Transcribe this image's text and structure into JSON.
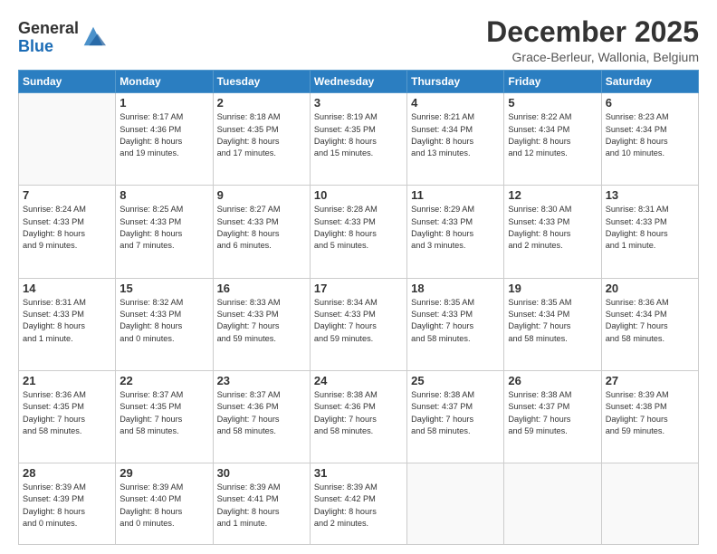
{
  "logo": {
    "general": "General",
    "blue": "Blue"
  },
  "header": {
    "month": "December 2025",
    "location": "Grace-Berleur, Wallonia, Belgium"
  },
  "days_header": [
    "Sunday",
    "Monday",
    "Tuesday",
    "Wednesday",
    "Thursday",
    "Friday",
    "Saturday"
  ],
  "weeks": [
    [
      {
        "day": "",
        "info": ""
      },
      {
        "day": "1",
        "info": "Sunrise: 8:17 AM\nSunset: 4:36 PM\nDaylight: 8 hours\nand 19 minutes."
      },
      {
        "day": "2",
        "info": "Sunrise: 8:18 AM\nSunset: 4:35 PM\nDaylight: 8 hours\nand 17 minutes."
      },
      {
        "day": "3",
        "info": "Sunrise: 8:19 AM\nSunset: 4:35 PM\nDaylight: 8 hours\nand 15 minutes."
      },
      {
        "day": "4",
        "info": "Sunrise: 8:21 AM\nSunset: 4:34 PM\nDaylight: 8 hours\nand 13 minutes."
      },
      {
        "day": "5",
        "info": "Sunrise: 8:22 AM\nSunset: 4:34 PM\nDaylight: 8 hours\nand 12 minutes."
      },
      {
        "day": "6",
        "info": "Sunrise: 8:23 AM\nSunset: 4:34 PM\nDaylight: 8 hours\nand 10 minutes."
      }
    ],
    [
      {
        "day": "7",
        "info": "Sunrise: 8:24 AM\nSunset: 4:33 PM\nDaylight: 8 hours\nand 9 minutes."
      },
      {
        "day": "8",
        "info": "Sunrise: 8:25 AM\nSunset: 4:33 PM\nDaylight: 8 hours\nand 7 minutes."
      },
      {
        "day": "9",
        "info": "Sunrise: 8:27 AM\nSunset: 4:33 PM\nDaylight: 8 hours\nand 6 minutes."
      },
      {
        "day": "10",
        "info": "Sunrise: 8:28 AM\nSunset: 4:33 PM\nDaylight: 8 hours\nand 5 minutes."
      },
      {
        "day": "11",
        "info": "Sunrise: 8:29 AM\nSunset: 4:33 PM\nDaylight: 8 hours\nand 3 minutes."
      },
      {
        "day": "12",
        "info": "Sunrise: 8:30 AM\nSunset: 4:33 PM\nDaylight: 8 hours\nand 2 minutes."
      },
      {
        "day": "13",
        "info": "Sunrise: 8:31 AM\nSunset: 4:33 PM\nDaylight: 8 hours\nand 1 minute."
      }
    ],
    [
      {
        "day": "14",
        "info": "Sunrise: 8:31 AM\nSunset: 4:33 PM\nDaylight: 8 hours\nand 1 minute."
      },
      {
        "day": "15",
        "info": "Sunrise: 8:32 AM\nSunset: 4:33 PM\nDaylight: 8 hours\nand 0 minutes."
      },
      {
        "day": "16",
        "info": "Sunrise: 8:33 AM\nSunset: 4:33 PM\nDaylight: 7 hours\nand 59 minutes."
      },
      {
        "day": "17",
        "info": "Sunrise: 8:34 AM\nSunset: 4:33 PM\nDaylight: 7 hours\nand 59 minutes."
      },
      {
        "day": "18",
        "info": "Sunrise: 8:35 AM\nSunset: 4:33 PM\nDaylight: 7 hours\nand 58 minutes."
      },
      {
        "day": "19",
        "info": "Sunrise: 8:35 AM\nSunset: 4:34 PM\nDaylight: 7 hours\nand 58 minutes."
      },
      {
        "day": "20",
        "info": "Sunrise: 8:36 AM\nSunset: 4:34 PM\nDaylight: 7 hours\nand 58 minutes."
      }
    ],
    [
      {
        "day": "21",
        "info": "Sunrise: 8:36 AM\nSunset: 4:35 PM\nDaylight: 7 hours\nand 58 minutes."
      },
      {
        "day": "22",
        "info": "Sunrise: 8:37 AM\nSunset: 4:35 PM\nDaylight: 7 hours\nand 58 minutes."
      },
      {
        "day": "23",
        "info": "Sunrise: 8:37 AM\nSunset: 4:36 PM\nDaylight: 7 hours\nand 58 minutes."
      },
      {
        "day": "24",
        "info": "Sunrise: 8:38 AM\nSunset: 4:36 PM\nDaylight: 7 hours\nand 58 minutes."
      },
      {
        "day": "25",
        "info": "Sunrise: 8:38 AM\nSunset: 4:37 PM\nDaylight: 7 hours\nand 58 minutes."
      },
      {
        "day": "26",
        "info": "Sunrise: 8:38 AM\nSunset: 4:37 PM\nDaylight: 7 hours\nand 59 minutes."
      },
      {
        "day": "27",
        "info": "Sunrise: 8:39 AM\nSunset: 4:38 PM\nDaylight: 7 hours\nand 59 minutes."
      }
    ],
    [
      {
        "day": "28",
        "info": "Sunrise: 8:39 AM\nSunset: 4:39 PM\nDaylight: 8 hours\nand 0 minutes."
      },
      {
        "day": "29",
        "info": "Sunrise: 8:39 AM\nSunset: 4:40 PM\nDaylight: 8 hours\nand 0 minutes."
      },
      {
        "day": "30",
        "info": "Sunrise: 8:39 AM\nSunset: 4:41 PM\nDaylight: 8 hours\nand 1 minute."
      },
      {
        "day": "31",
        "info": "Sunrise: 8:39 AM\nSunset: 4:42 PM\nDaylight: 8 hours\nand 2 minutes."
      },
      {
        "day": "",
        "info": ""
      },
      {
        "day": "",
        "info": ""
      },
      {
        "day": "",
        "info": ""
      }
    ]
  ]
}
